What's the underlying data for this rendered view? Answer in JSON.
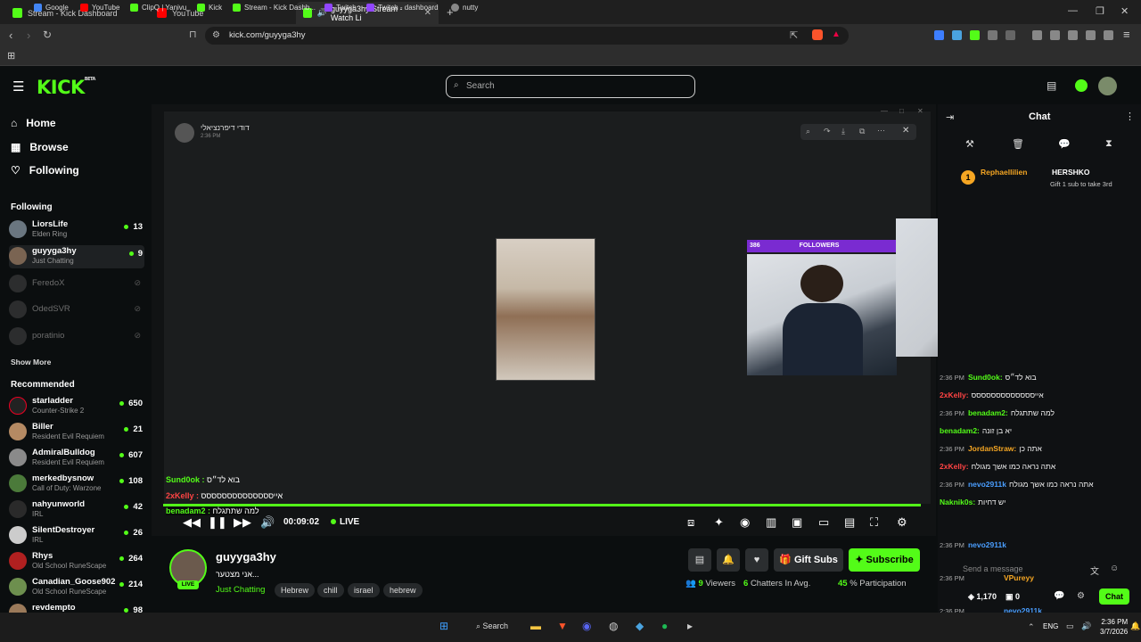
{
  "browser": {
    "tabs": [
      {
        "title": "Stream - Kick Dashboard",
        "color": "#53fc18"
      },
      {
        "title": "YouTube",
        "color": "#ff0000"
      },
      {
        "title": "guyyga3hy Stream - Watch Li",
        "color": "#53fc18"
      }
    ],
    "url": "kick.com/guyyga3hy",
    "bookmarks": [
      {
        "label": "Google",
        "color": "#4285f4"
      },
      {
        "label": "YouTube",
        "color": "#ff0000"
      },
      {
        "label": "ClipQ | Yanivu",
        "color": "#53fc18"
      },
      {
        "label": "Kick",
        "color": "#53fc18"
      },
      {
        "label": "Stream - Kick Dashb...",
        "color": "#53fc18"
      },
      {
        "label": "Twitch",
        "color": "#9146ff"
      },
      {
        "label": "Twitch - dashboard",
        "color": "#9146ff"
      },
      {
        "label": "nutty",
        "color": "#888888"
      }
    ]
  },
  "kick": {
    "logo": "KICK",
    "logo_sup": "BETA",
    "search_placeholder": "Search",
    "accent": "#53fc18"
  },
  "sidebar": {
    "nav": [
      {
        "label": "Home",
        "icon": "home-icon"
      },
      {
        "label": "Browse",
        "icon": "browse-icon"
      },
      {
        "label": "Following",
        "icon": "heart-icon"
      }
    ],
    "following_header": "Following",
    "following": [
      {
        "name": "LiorsLife",
        "category": "Elden Ring",
        "count": "13",
        "online": true
      },
      {
        "name": "guyyga3hy",
        "category": "Just Chatting",
        "count": "9",
        "online": true
      },
      {
        "name": "FeredoX",
        "online": false
      },
      {
        "name": "OdedSVR",
        "online": false
      },
      {
        "name": "poratinio",
        "online": false
      }
    ],
    "show_more": "Show More",
    "recommended_header": "Recommended",
    "recommended": [
      {
        "name": "starladder",
        "category": "Counter-Strike 2",
        "count": "650"
      },
      {
        "name": "Biller",
        "category": "Resident Evil Requiem",
        "count": "21"
      },
      {
        "name": "AdmiralBulldog",
        "category": "Resident Evil Requiem",
        "count": "607"
      },
      {
        "name": "merkedbysnow",
        "category": "Call of Duty: Warzone",
        "count": "108"
      },
      {
        "name": "nahyunworld",
        "category": "IRL",
        "count": "42"
      },
      {
        "name": "SilentDestroyer",
        "category": "IRL",
        "count": "26"
      },
      {
        "name": "Rhys",
        "category": "Old School RuneScape",
        "count": "264"
      },
      {
        "name": "Canadian_Goose902",
        "category": "Old School RuneScape",
        "count": "214"
      },
      {
        "name": "revdempto",
        "category": "",
        "count": "98"
      }
    ]
  },
  "player": {
    "overlay_user": "דודי דיפרנציאלי",
    "followers_label": "FOLLOWERS",
    "followers_count": "386",
    "time": "00:09:02",
    "live": "LIVE",
    "overlay_chat": [
      {
        "user": "Sund0ok :",
        "text": "בוא לד״ס",
        "color": "#53fc18"
      },
      {
        "user": "2xKelly :",
        "text": "אייסססססססססססססס",
        "color": "#ff4444"
      },
      {
        "user": "benadam2 :",
        "text": "למה שתתגלח",
        "color": "#53fc18"
      }
    ]
  },
  "stream": {
    "name": "guyyga3hy",
    "live_badge": "LIVE",
    "title": "אני מצטער...",
    "category": "Just Chatting",
    "tags": [
      "Hebrew",
      "chill",
      "israel",
      "hebrew"
    ],
    "gift_label": "Gift Subs",
    "subscribe_label": "Subscribe",
    "viewers_count": "9",
    "viewers_label": "Viewers",
    "chatters_count": "6",
    "chatters_label": "Chatters In Avg.",
    "participation_count": "45",
    "participation_label": "% Participation"
  },
  "chat": {
    "title": "Chat",
    "pinned_user1": "Rephaellilien",
    "pinned_user2": "HERSHKO",
    "pinned_text": "Gift 1 sub to take 3rd",
    "messages": [
      {
        "time": "2:36 PM",
        "user": "Sund0ok:",
        "text": "בוא לד״ס",
        "color": "#53fc18"
      },
      {
        "time": "",
        "user": "2xKelly:",
        "text": "אייססססססססססססס",
        "color": "#ff4444"
      },
      {
        "time": "2:36 PM",
        "user": "benadam2:",
        "text": "למה שתתגלח",
        "color": "#53fc18"
      },
      {
        "time": "",
        "user": "benadam2:",
        "text": "יא בן זונה",
        "color": "#53fc18"
      },
      {
        "time": "2:36 PM",
        "user": "JordanStraw:",
        "text": "אתה כן",
        "color": "#f5a623"
      },
      {
        "time": "",
        "user": "2xKelly:",
        "text": "אתה נראה כמו אשך מגולח",
        "color": "#ff4444"
      },
      {
        "time": "2:36 PM",
        "user": "nevo2911k",
        "text": "אתה נראה כמו אשך מגולח",
        "color": "#4a9eff"
      },
      {
        "time": "",
        "user": "Naknik0s:",
        "text": "יש דחיות",
        "color": "#53fc18"
      },
      {
        "time": "2:36 PM",
        "user": "nevo2911k",
        "text": "",
        "color": "#4a9eff"
      },
      {
        "time": "2:36 PM",
        "user": "VPureyy",
        "text": "",
        "color": "#f5a623"
      },
      {
        "time": "2:36 PM",
        "user": "nevo2911k",
        "text": "",
        "color": "#4a9eff"
      }
    ],
    "input_placeholder": "Send a message",
    "points": "1,170",
    "zero": "0",
    "chat_button": "Chat"
  },
  "taskbar": {
    "search_label": "Search",
    "lang": "ENG",
    "time": "2:36 PM",
    "date": "3/7/2026"
  }
}
